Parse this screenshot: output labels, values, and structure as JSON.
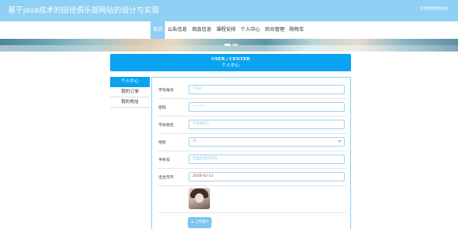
{
  "header": {
    "site_title": "基于java技术的田径俱乐部网站的设计与实现",
    "welcome": "欢迎使用网站系统"
  },
  "nav": {
    "items": [
      {
        "label": "首页",
        "active": true
      },
      {
        "label": "公告信息",
        "active": false
      },
      {
        "label": "商品信息",
        "active": false
      },
      {
        "label": "课程安排",
        "active": false
      },
      {
        "label": "个人中心",
        "active": false
      },
      {
        "label": "后台管理",
        "active": false
      },
      {
        "label": "购物车",
        "active": false
      }
    ]
  },
  "user_center": {
    "title_en": "USER / CENTER",
    "title_cn": "个人中心"
  },
  "sidebar": {
    "items": [
      {
        "label": "个人中心",
        "active": true
      },
      {
        "label": "我的订单",
        "active": false
      },
      {
        "label": "我的地址",
        "active": false
      }
    ]
  },
  "form": {
    "student_id": {
      "label": "学号账号",
      "value": "学员1"
    },
    "password": {
      "label": "密码",
      "value": "••••••"
    },
    "student_name": {
      "label": "学员姓名",
      "value": "学员姓名1"
    },
    "gender": {
      "label": "性别",
      "value": "男"
    },
    "phone": {
      "label": "手机号",
      "value": "无固定电话号码"
    },
    "birthdate": {
      "label": "出生年月",
      "value": "2026-02-12"
    },
    "upload_button": "上传图片"
  },
  "colors": {
    "topbar": "#8fd0f4",
    "accent": "#0aa3f2"
  }
}
